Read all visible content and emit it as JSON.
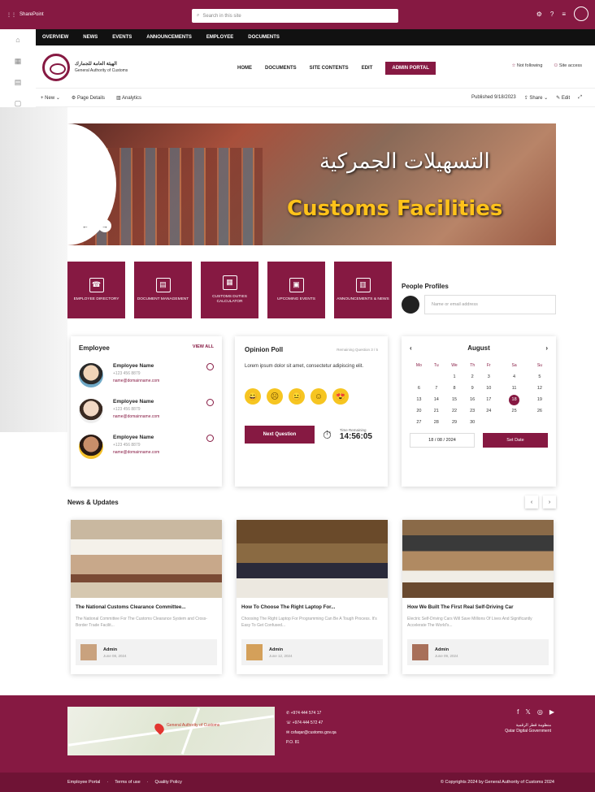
{
  "suite": {
    "app_name": "SharePoint",
    "search_placeholder": "Search in this site"
  },
  "top_nav": [
    "OVERVIEW",
    "NEWS",
    "EVENTS",
    "ANNOUNCEMENTS",
    "EMPLOYEE",
    "DOCUMENTS"
  ],
  "logo": {
    "org": "General Authority of Customs"
  },
  "main_nav": {
    "items": [
      "HOME",
      "DOCUMENTS",
      "SITE CONTENTS",
      "EDIT"
    ],
    "admin": "ADMIN PORTAL",
    "follow": "Not following",
    "access": "Site access"
  },
  "commands": {
    "new": "+ New ⌄",
    "page_details": "Page Details",
    "analytics": "Analytics",
    "published": "Published 9/18/2023",
    "share": "Share ⌄",
    "edit": "Edit"
  },
  "hero": {
    "title_ar": "التسهيلات الجمركية",
    "title_en": "Customs Facilities"
  },
  "tiles": [
    {
      "label": "EMPLOYEE DIRECTORY",
      "icon": "phonebook-icon"
    },
    {
      "label": "DOCUMENT MANAGEMENT",
      "icon": "document-icon"
    },
    {
      "label": "CUSTOMS DUTIES CALCULATOR",
      "icon": "calculator-icon"
    },
    {
      "label": "UPCOMING EVENTS",
      "icon": "calendar-icon"
    },
    {
      "label": "ANNOUNCEMENTS & NEWS",
      "icon": "news-icon"
    }
  ],
  "people": {
    "title": "People Profiles",
    "placeholder": "Name or email address"
  },
  "employee": {
    "title": "Employee",
    "view_all": "VIEW ALL",
    "list": [
      {
        "name": "Employee Name",
        "phone": "+123 456 8879",
        "email": "name@domainname.com"
      },
      {
        "name": "Employee Name",
        "phone": "+123 456 8879",
        "email": "name@domainname.com"
      },
      {
        "name": "Employee Name",
        "phone": "+123 456 8879",
        "email": "name@domainname.com"
      }
    ]
  },
  "poll": {
    "title": "Opinion Poll",
    "status": "Remaining Question 3 / 5",
    "question": "Lorem ipsum dolor sit amet, consectetur adipiscing elit.",
    "button": "Next Question",
    "timer_label": "Time Remaining",
    "timer": "14:56:05"
  },
  "calendar": {
    "month": "August",
    "days": [
      "Mo",
      "Tu",
      "We",
      "Th",
      "Fr",
      "Sa",
      "Su"
    ],
    "weeks": [
      [
        "",
        "",
        "1",
        "2",
        "3",
        "4",
        "5"
      ],
      [
        "6",
        "7",
        "8",
        "9",
        "10",
        "11",
        "12"
      ],
      [
        "13",
        "14",
        "15",
        "16",
        "17",
        "18",
        "19"
      ],
      [
        "20",
        "21",
        "22",
        "23",
        "24",
        "25",
        "26"
      ],
      [
        "27",
        "28",
        "29",
        "30",
        "",
        "",
        ""
      ]
    ],
    "selected": "18",
    "date_value": "18 / 08 / 2024",
    "set_label": "Set Date"
  },
  "news": {
    "title": "News & Updates",
    "items": [
      {
        "title": "The National Customs Clearance Committee...",
        "desc": "The National Committee For The Customs Clearance System and Cross-Border Trade Facilit...",
        "author": "Admin",
        "date": "June 08, 2024"
      },
      {
        "title": "How To Choose The Right Laptop For...",
        "desc": "Choosing The Right Laptop For Programming Can Be A Tough Process. It's Easy To Get Confused...",
        "author": "Admin",
        "date": "June 12, 2024"
      },
      {
        "title": "How We Built The First Real Self-Driving Car",
        "desc": "Electric Self-Driving Cars Will Save Millions Of Lives And Significantly Accelerate The World's...",
        "author": "Admin",
        "date": "June 09, 2024"
      }
    ]
  },
  "footer": {
    "phone1": "+974 444 574 17",
    "phone2": "+974 444 572 47",
    "email": "csfaqar@customs.gov.qa",
    "po": "P.O. 81",
    "qdg": "Qatar Digital Government",
    "map_label": "General Authority of Customs",
    "links": [
      "Employee Portal",
      "Terms of use",
      "Quality Policy"
    ],
    "copyright": "© Copyrights 2024 by General Authority of Customs 2024"
  }
}
